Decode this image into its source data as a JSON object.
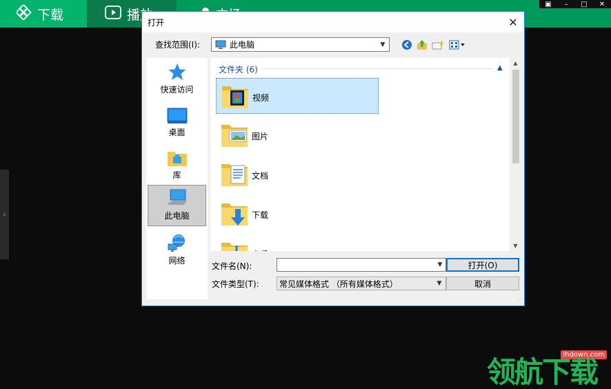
{
  "app": {
    "tabs": [
      {
        "label": "下载"
      },
      {
        "label": "播放"
      },
      {
        "label": "广场"
      }
    ],
    "window_controls": [
      "▣",
      "–",
      "□",
      "✕"
    ],
    "side_handle": "‹"
  },
  "watermark": {
    "url": "lhdown.com",
    "text": "领航下载"
  },
  "dialog": {
    "title": "打开",
    "close": "✕",
    "look_in_label": "查找范围(I):",
    "look_in_value": "此电脑",
    "places": [
      {
        "label": "快速访问",
        "icon": "star-icon"
      },
      {
        "label": "桌面",
        "icon": "desktop-icon"
      },
      {
        "label": "库",
        "icon": "library-icon"
      },
      {
        "label": "此电脑",
        "icon": "computer-icon",
        "selected": true
      },
      {
        "label": "网络",
        "icon": "network-icon"
      }
    ],
    "group_header": "文件夹 (6)",
    "folders": [
      {
        "name": "视频",
        "icon": "video-folder-icon",
        "selected": true
      },
      {
        "name": "图片",
        "icon": "pictures-folder-icon"
      },
      {
        "name": "文档",
        "icon": "documents-folder-icon"
      },
      {
        "name": "下载",
        "icon": "downloads-folder-icon"
      },
      {
        "name": "音乐",
        "icon": "music-folder-icon"
      }
    ],
    "filename_label": "文件名(N):",
    "filename_value": "",
    "filetype_label": "文件类型(T):",
    "filetype_value": "常见媒体格式 （所有媒体格式）",
    "open_button": "打开(O)",
    "cancel_button": "取消"
  },
  "colors": {
    "brand_green": "#019a5b",
    "dialog_border": "#1883d7",
    "selection": "#cce8ff"
  }
}
